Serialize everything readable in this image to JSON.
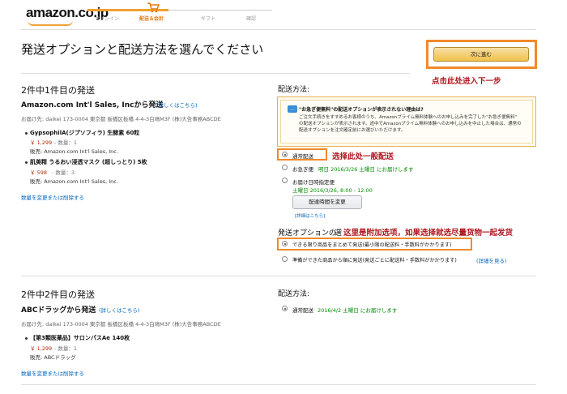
{
  "header": {
    "logo": "amazon.co.jp",
    "steps": [
      "サインイン",
      "配送＆会計",
      "ギフト",
      "確認"
    ]
  },
  "page": {
    "title": "発送オプションと配送方法を選んでください",
    "continue_label": "次に進む",
    "annotation_continue": "点击此处进入下一步"
  },
  "shipment1": {
    "heading": "2件中1件目の発送",
    "seller": "Amazon.com Int'l Sales, Incから発送",
    "details_link": "(詳しくはこちら)",
    "address": "お届け先: daikei 173-0004 東京都 板橋区板橋 4-4-3白鳩M3F (株)大告事務ABCDE",
    "items": [
      {
        "name": "GypsophilA(ジプソフィラ) 生酵素 60粒",
        "price": "￥ 1,299",
        "qty": "- 数量：1",
        "sold_by": "販売: Amazon.com Int'l Sales, Inc."
      },
      {
        "name": "肌美精 うるおい浸透マスク (超しっとり) 5枚",
        "price": "￥ 598",
        "qty": "- 数量：3",
        "sold_by": "販売: Amazon.com Int'l Sales, Inc."
      }
    ],
    "change_qty_link": "数量を変更または削除する",
    "method_label": "配送方法:",
    "notice": {
      "title": "\"お急ぎ便無料\"の配送オプションが表示されない理由は?",
      "lines": [
        "ご注文手続きをすすめるお客様のうち、Amazonプライム無料体験へのお申し込みを完了した\"お急ぎ便無料\"",
        "の配送オプションが表示されます。途中でAmazonプライム無料体験へのお申し込みを中止した場合は、通常の",
        "配送オプションを注文確定前にお選びいただけます。"
      ]
    },
    "options": {
      "standard": "通常配送",
      "express_label": "お急ぎ便",
      "express_date": "明日 2016/3/26 土曜日 にお届けします",
      "scheduled_label": "お届け日時指定便",
      "scheduled_date": "土曜日 2016/3/26, 8:00 - 12:00",
      "change_time_button": "配達時間を変更",
      "details_link": "[詳細はこちら]"
    },
    "annotation_standard": "选择此处一般配送",
    "ship_option_label": "発送オプションの",
    "ship_option_suffix": "選",
    "annotation_shipping": "这里是附加选项，如果选择就选尽量货物一起发货",
    "ship_option_together": "できる限り商品をまとめて発送(最小限の配送料・手数料がかかります)",
    "ship_option_separate": "準備ができた商品から順に発送(発送ごとに配送料・手数料がかかります)",
    "ship_option_details": "(詳細を見る)"
  },
  "shipment2": {
    "heading": "2件中2件目の発送",
    "seller": "ABCドラッグから発送",
    "details_link": "(詳しくはこちら)",
    "address": "お届け先: daikei 173-0004 東京都 板橋区板橋 4-4-3白鳩M3F (株)大告事務ABCDE",
    "items": [
      {
        "name": "【第3類医薬品】サロンパスAe 140枚",
        "price": "￥ 1,299",
        "qty": "- 数量：1",
        "sold_by": "販売: ABCドラッグ"
      }
    ],
    "change_qty_link": "数量を変更または削除する",
    "method_label": "配送方法:",
    "standard": "通常配送",
    "standard_date": "2016/4/2 土曜日 にお届けします"
  }
}
